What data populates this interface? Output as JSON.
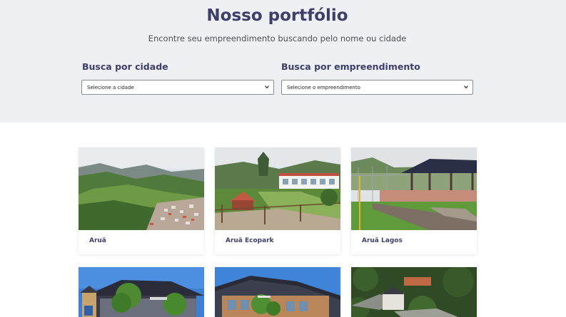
{
  "hero": {
    "title": "Nosso portfólio",
    "subtitle": "Encontre seu empreendimento buscando pelo nome ou cidade"
  },
  "filters": {
    "city": {
      "label": "Busca por cidade",
      "selected": "Selecione a cidade"
    },
    "project": {
      "label": "Busca por empreendimento",
      "selected": "Selecione o empreendimento"
    }
  },
  "projects": [
    {
      "name": "Aruã",
      "photo": "mountain-town-landscape"
    },
    {
      "name": "Aruã Ecopark",
      "photo": "clubhouse-garden"
    },
    {
      "name": "Aruã Lagos",
      "photo": "sports-court-pavilion"
    },
    {
      "name": "",
      "photo": "house-with-trees"
    },
    {
      "name": "",
      "photo": "clubhouse-facade"
    },
    {
      "name": "",
      "photo": "aerial-forest-house"
    }
  ],
  "colors": {
    "heading": "#3d3f6b",
    "hero_bg": "#eef0f3"
  }
}
